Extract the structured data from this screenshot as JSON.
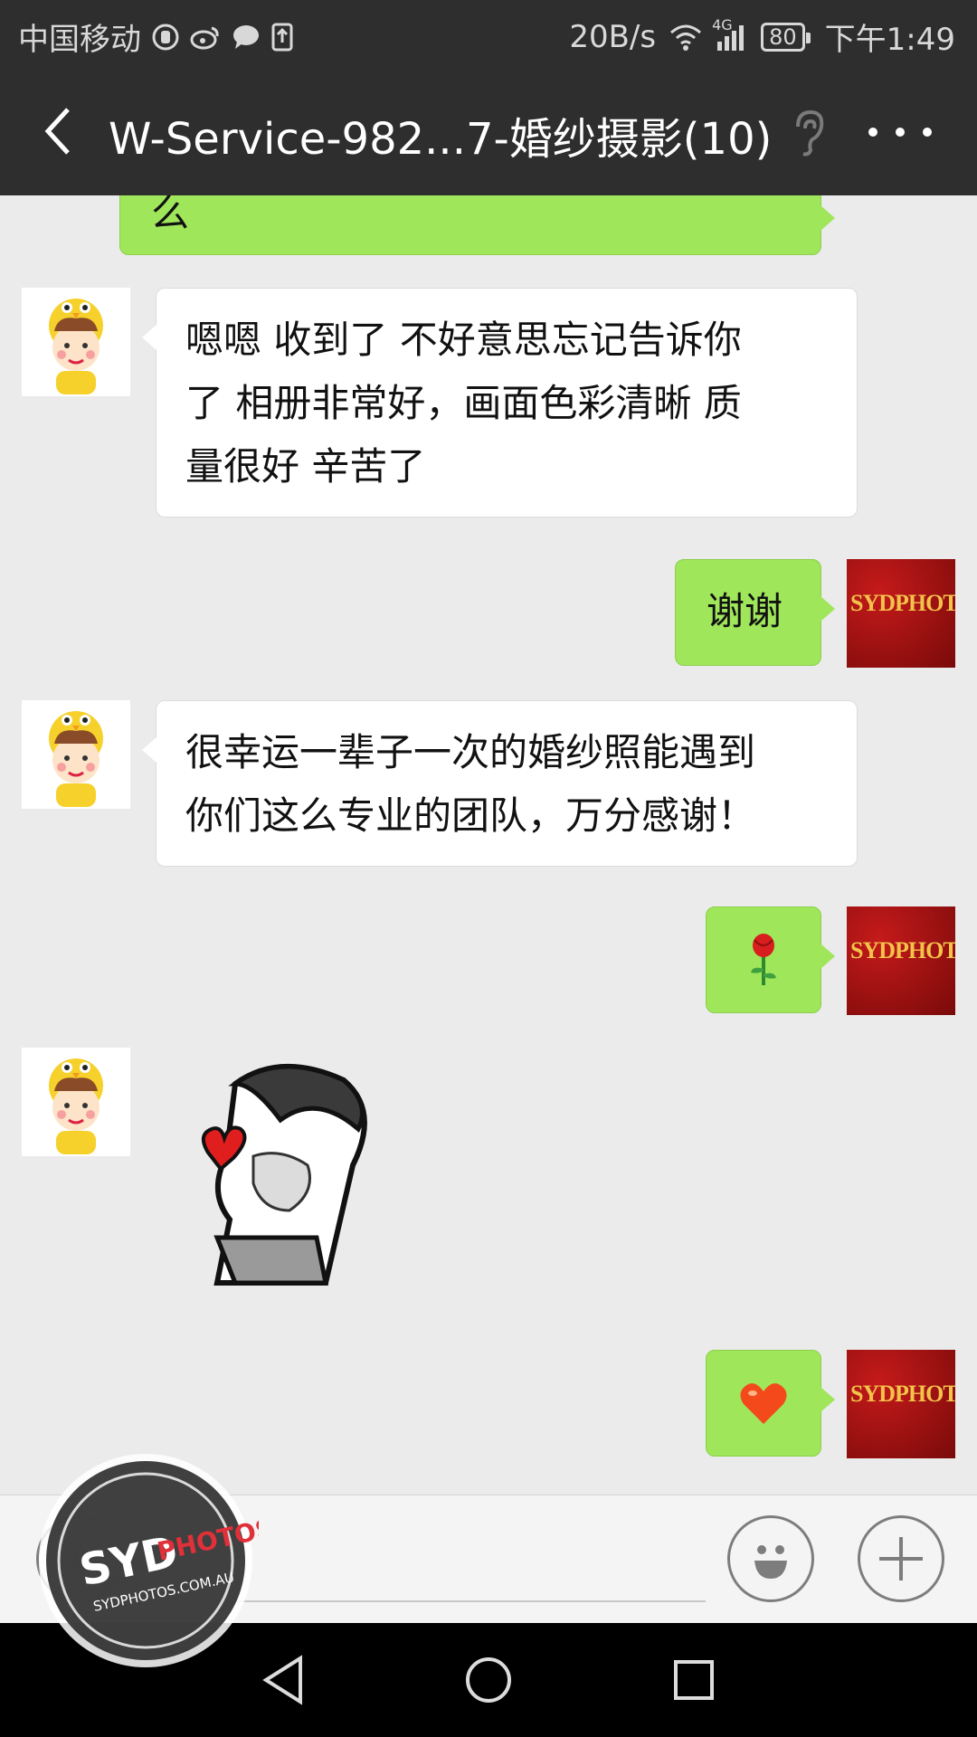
{
  "status_bar": {
    "carrier": "中国移动",
    "network_speed": "20B/s",
    "network_type": "4G",
    "battery": "80",
    "time": "下午1:49"
  },
  "header": {
    "title": "W-Service-982...7-婚纱摄影(10)",
    "back_icon": "chevron-left-icon",
    "ear_icon": "ear-icon",
    "more_icon": "more-icon"
  },
  "messages": [
    {
      "from": "me",
      "type": "text",
      "text": "么"
    },
    {
      "from": "other",
      "type": "text",
      "lines": [
        "嗯嗯  收到了 不好意思忘记告诉你",
        "了  相册非常好，画面色彩清晰 质",
        "量很好  辛苦了"
      ]
    },
    {
      "from": "me",
      "type": "text",
      "text": "谢谢"
    },
    {
      "from": "other",
      "type": "text",
      "lines": [
        "很幸运一辈子一次的婚纱照能遇到",
        "你们这么专业的团队，万分感谢！"
      ]
    },
    {
      "from": "me",
      "type": "emoji",
      "text": "🌹",
      "icon": "rose-icon"
    },
    {
      "from": "other",
      "type": "sticker",
      "icon": "heart-sticker"
    },
    {
      "from": "me",
      "type": "emoji",
      "text": "❤",
      "icon": "heart-icon"
    }
  ],
  "avatars": {
    "me_label": "SYDPHOTOS"
  },
  "input_bar": {
    "voice_icon": "voice-icon",
    "emoji_icon": "smiley-icon",
    "plus_icon": "plus-icon"
  },
  "watermark": {
    "line1_left": "SYD",
    "line1_right": "PHOTOS",
    "line2": "SYDPHOTOS.COM.AU"
  },
  "colors": {
    "header_bg": "#2e2e2e",
    "chat_bg": "#ebebeb",
    "out_bubble": "#9fe65b",
    "in_bubble": "#ffffff"
  }
}
